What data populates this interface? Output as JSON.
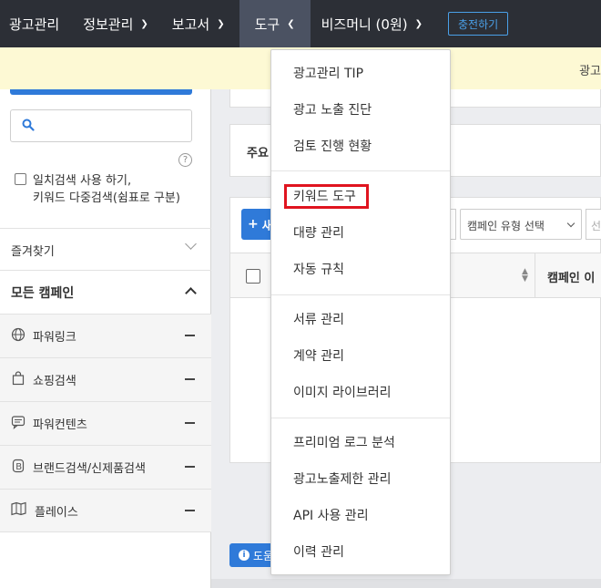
{
  "nav": {
    "items": [
      {
        "label": "광고관리",
        "caret": false
      },
      {
        "label": "정보관리",
        "caret": true
      },
      {
        "label": "보고서",
        "caret": true
      },
      {
        "label": "도구",
        "caret": true,
        "active": true
      },
      {
        "label": "비즈머니 (0원)",
        "caret": true
      }
    ],
    "charge_label": "충전하기"
  },
  "notice": {
    "text": "광고"
  },
  "sidebar": {
    "search_placeholder": "",
    "exact_search_line1": "일치검색 사용 하기,",
    "exact_search_line2": "키워드 다중검색(쉼표로 구분)",
    "favorites_label": "즐겨찾기",
    "all_campaigns_label": "모든 캠페인",
    "campaigns": [
      {
        "label": "파워링크",
        "icon": "globe-icon"
      },
      {
        "label": "쇼핑검색",
        "icon": "shopping-bag-icon"
      },
      {
        "label": "파워컨텐츠",
        "icon": "chat-icon"
      },
      {
        "label": "브랜드검색/신제품검색",
        "icon": "brand-b-icon"
      },
      {
        "label": "플레이스",
        "icon": "map-icon"
      }
    ]
  },
  "main": {
    "summary_title": "주요",
    "new_button_label": "새",
    "campaign_type_select": "캠페인 유형 선택",
    "next_select_partial": "선",
    "column_campaign_name": "캠페인 이",
    "help_button_label": "도움"
  },
  "dropdown": {
    "groups": [
      [
        "광고관리 TIP",
        "광고 노출 진단",
        "검토 진행 현황"
      ],
      [
        "키워드 도구",
        "대량 관리",
        "자동 규칙"
      ],
      [
        "서류 관리",
        "계약 관리",
        "이미지 라이브러리"
      ],
      [
        "프리미엄 로그 분석",
        "광고노출제한 관리",
        "API 사용 관리",
        "이력 관리"
      ]
    ],
    "highlighted": "키워드 도구"
  },
  "colors": {
    "nav_bg": "#2c2f36",
    "nav_active_bg": "#4b5262",
    "accent_blue": "#2f7ad9",
    "notice_bg": "#fdf9d4",
    "highlight_red": "#e0141f"
  }
}
